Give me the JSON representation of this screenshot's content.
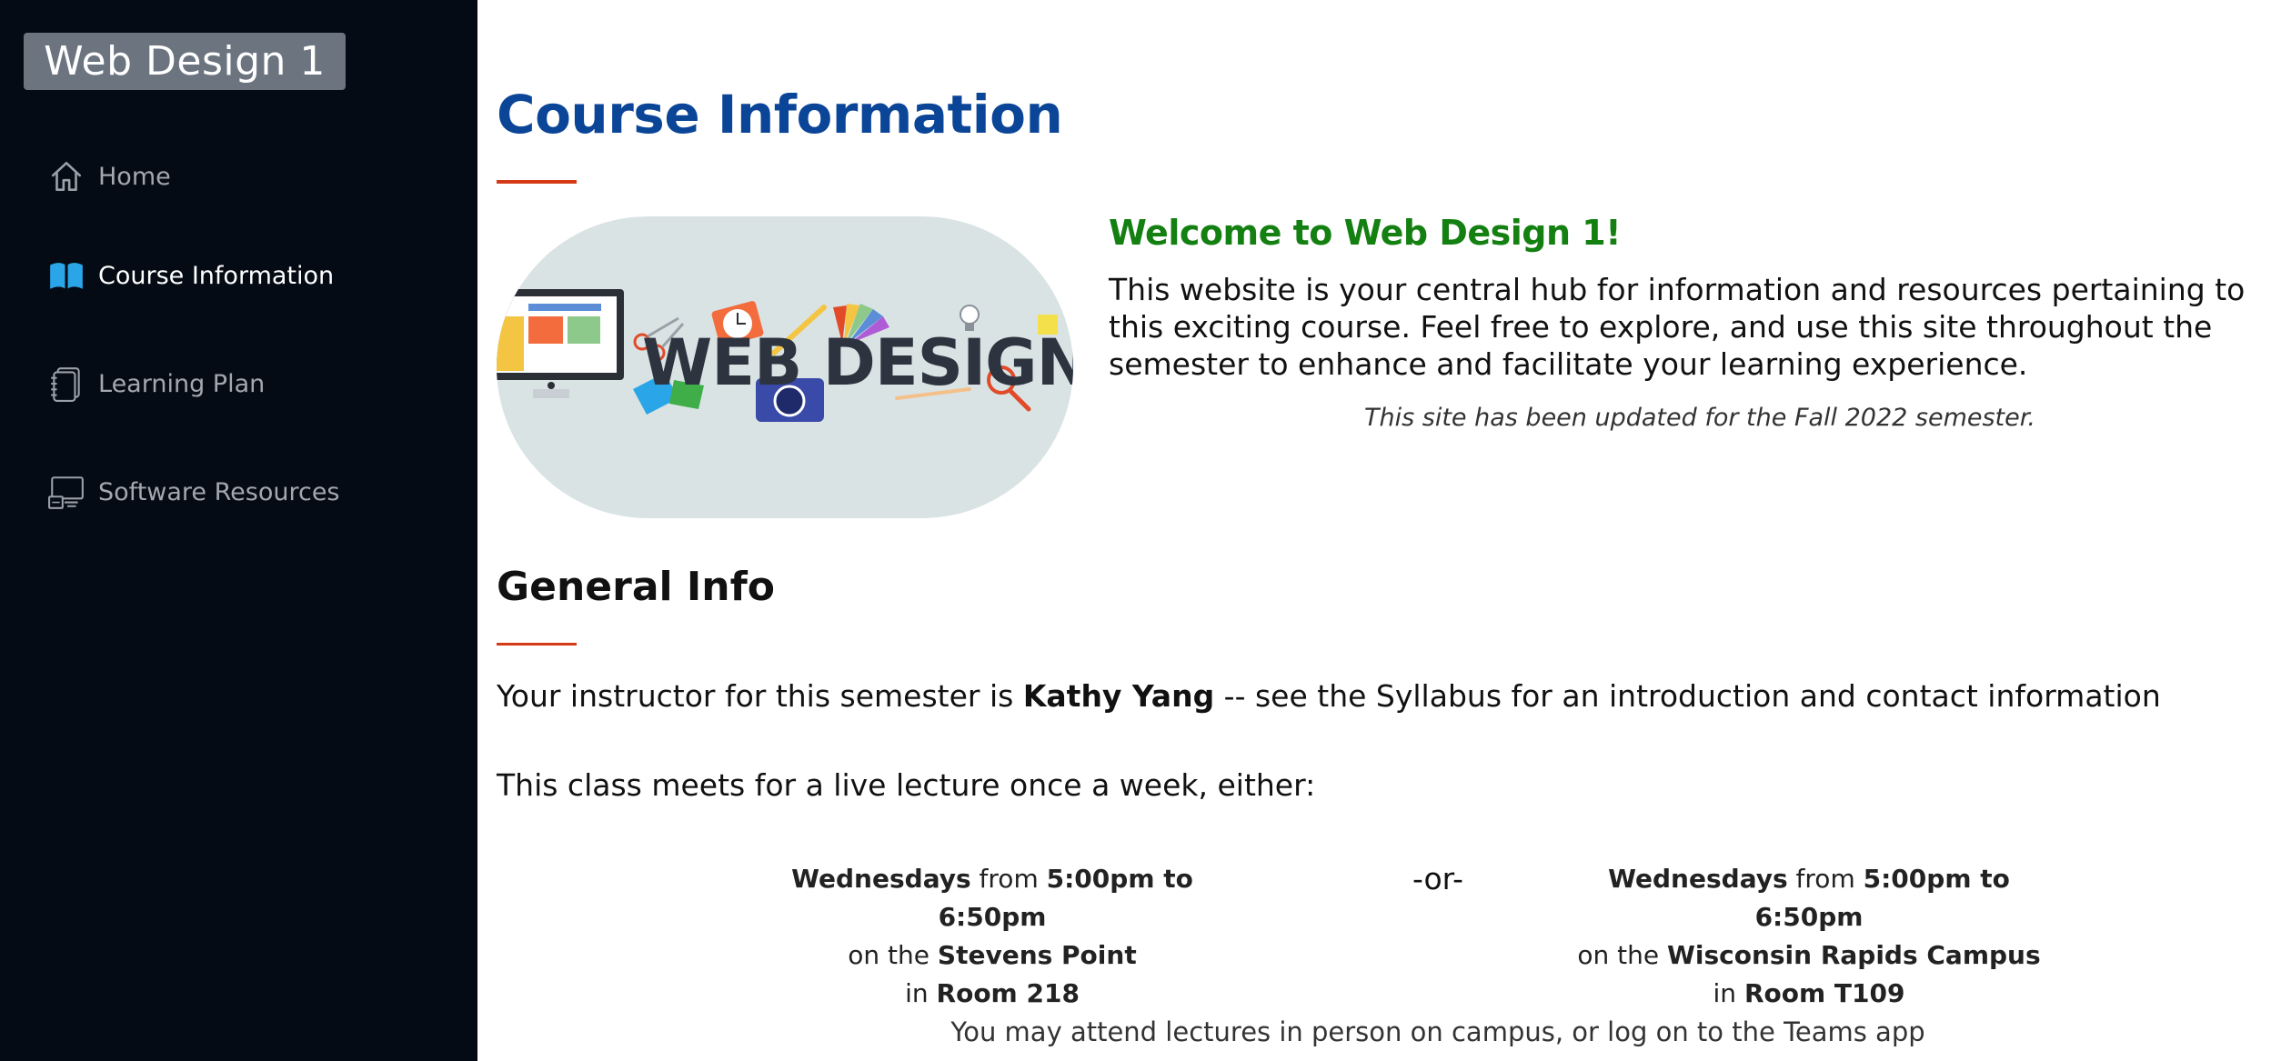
{
  "sidebar": {
    "site_title": "Web Design 1",
    "items": [
      {
        "label": "Home",
        "icon": "home-icon",
        "active": false
      },
      {
        "label": "Course Information",
        "icon": "book-icon",
        "active": true
      },
      {
        "label": "Learning Plan",
        "icon": "notebook-icon",
        "active": false
      },
      {
        "label": "Software Resources",
        "icon": "computer-icon",
        "active": false
      }
    ]
  },
  "main": {
    "page_title": "Course Information",
    "hero_image": {
      "word": "WEB DESIGN"
    },
    "welcome": {
      "heading": "Welcome to Web Design 1!",
      "text": "This website is your central hub for information and resources pertaining to this exciting course. Feel free to explore, and use this site throughout the semester to enhance and facilitate your learning experience.",
      "note": "This site has been updated for the Fall 2022 semester."
    },
    "general_info": {
      "heading": "General Info",
      "instructor_prefix": "Your instructor for this semester is ",
      "instructor_name": "Kathy Yang",
      "instructor_suffix": " -- see the Syllabus for an introduction and contact information",
      "meets_text": "This class meets for a live lecture once a week, either:",
      "or_text": "-or-",
      "sessions": [
        {
          "day": "Wednesdays",
          "from_word": " from ",
          "time": "5:00pm to 6:50pm",
          "on_the": "on the ",
          "campus": "Stevens Point",
          "in_word": "in ",
          "room": "Room 218"
        },
        {
          "day": "Wednesdays",
          "from_word": " from ",
          "time": "5:00pm to 6:50pm",
          "on_the": "on the ",
          "campus": "Wisconsin Rapids Campus",
          "in_word": "in ",
          "room": "Room T109"
        }
      ],
      "attend_text": "You may attend lectures in person on campus, or log on to the Teams app"
    }
  },
  "colors": {
    "sidebar_bg": "#050b15",
    "title_blue": "#0a4597",
    "accent_red": "#d43a15",
    "welcome_green": "#138011",
    "active_icon_blue": "#2aa6e8"
  }
}
